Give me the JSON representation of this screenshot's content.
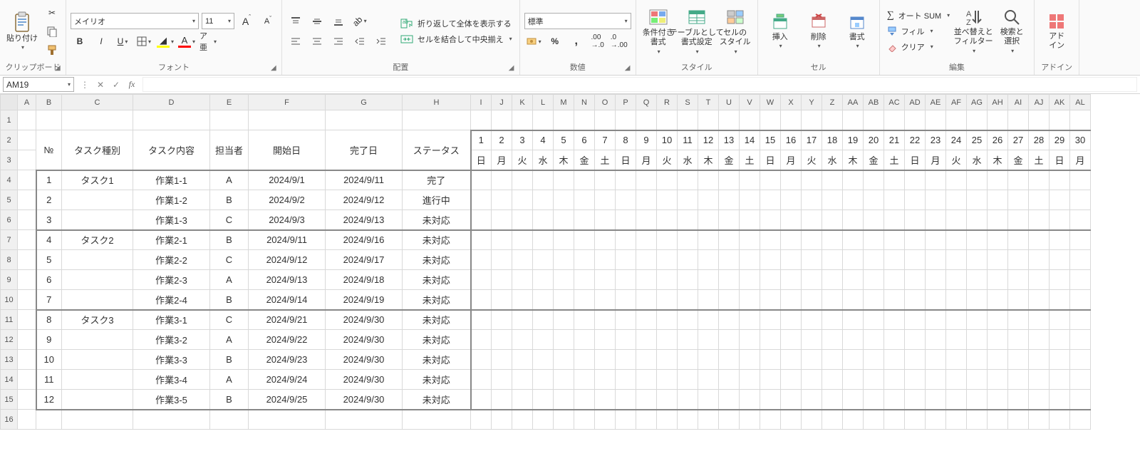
{
  "name_box": "AM19",
  "ribbon": {
    "clipboard": {
      "label": "クリップボード",
      "paste": "貼り付け"
    },
    "font": {
      "label": "フォント",
      "family": "メイリオ",
      "size": "11"
    },
    "align": {
      "label": "配置",
      "wrap": "折り返して全体を表示する",
      "merge": "セルを結合して中央揃え"
    },
    "number": {
      "label": "数値",
      "format": "標準"
    },
    "styles": {
      "label": "スタイル",
      "cond": "条件付き\n書式",
      "table": "テーブルとして\n書式設定",
      "cell": "セルの\nスタイル"
    },
    "cells": {
      "label": "セル",
      "insert": "挿入",
      "delete": "削除",
      "format": "書式"
    },
    "edit": {
      "label": "編集",
      "sum": "オート SUM",
      "fill": "フィル",
      "clear": "クリア",
      "sort": "並べ替えと\nフィルター",
      "find": "検索と\n選択"
    },
    "addin": {
      "label": "アドイン",
      "btn": "アド\nイン"
    }
  },
  "columns": [
    "A",
    "B",
    "C",
    "D",
    "E",
    "F",
    "G",
    "H",
    "I",
    "J",
    "K",
    "L",
    "M",
    "N",
    "O",
    "P",
    "Q",
    "R",
    "S",
    "T",
    "U",
    "V",
    "W",
    "X",
    "Y",
    "Z",
    "AA",
    "AB",
    "AC",
    "AD",
    "AE",
    "AF",
    "AG",
    "AH",
    "AI",
    "AJ",
    "AK",
    "AL"
  ],
  "col_widths": {
    "A": 26,
    "B": 36,
    "C": 100,
    "D": 108,
    "E": 54,
    "F": 108,
    "G": 108,
    "H": 96,
    "cal": 29
  },
  "main_headers": [
    "№",
    "タスク種別",
    "タスク内容",
    "担当者",
    "開始日",
    "完了日",
    "ステータス"
  ],
  "days": [
    1,
    2,
    3,
    4,
    5,
    6,
    7,
    8,
    9,
    10,
    11,
    12,
    13,
    14,
    15,
    16,
    17,
    18,
    19,
    20,
    21,
    22,
    23,
    24,
    25,
    26,
    27,
    28,
    29,
    30
  ],
  "dows": [
    "日",
    "月",
    "火",
    "水",
    "木",
    "金",
    "土",
    "日",
    "月",
    "火",
    "水",
    "木",
    "金",
    "土",
    "日",
    "月",
    "火",
    "水",
    "木",
    "金",
    "土",
    "日",
    "月",
    "火",
    "水",
    "木",
    "金",
    "土",
    "日",
    "月"
  ],
  "tasks": [
    {
      "no": 1,
      "type": "タスク1",
      "work": "作業1-1",
      "owner": "A",
      "start": "2024/9/1",
      "end": "2024/9/11",
      "status": "完了"
    },
    {
      "no": 2,
      "type": "",
      "work": "作業1-2",
      "owner": "B",
      "start": "2024/9/2",
      "end": "2024/9/12",
      "status": "進行中"
    },
    {
      "no": 3,
      "type": "",
      "work": "作業1-3",
      "owner": "C",
      "start": "2024/9/3",
      "end": "2024/9/13",
      "status": "未対応"
    },
    {
      "no": 4,
      "type": "タスク2",
      "work": "作業2-1",
      "owner": "B",
      "start": "2024/9/11",
      "end": "2024/9/16",
      "status": "未対応"
    },
    {
      "no": 5,
      "type": "",
      "work": "作業2-2",
      "owner": "C",
      "start": "2024/9/12",
      "end": "2024/9/17",
      "status": "未対応"
    },
    {
      "no": 6,
      "type": "",
      "work": "作業2-3",
      "owner": "A",
      "start": "2024/9/13",
      "end": "2024/9/18",
      "status": "未対応"
    },
    {
      "no": 7,
      "type": "",
      "work": "作業2-4",
      "owner": "B",
      "start": "2024/9/14",
      "end": "2024/9/19",
      "status": "未対応"
    },
    {
      "no": 8,
      "type": "タスク3",
      "work": "作業3-1",
      "owner": "C",
      "start": "2024/9/21",
      "end": "2024/9/30",
      "status": "未対応"
    },
    {
      "no": 9,
      "type": "",
      "work": "作業3-2",
      "owner": "A",
      "start": "2024/9/22",
      "end": "2024/9/30",
      "status": "未対応"
    },
    {
      "no": 10,
      "type": "",
      "work": "作業3-3",
      "owner": "B",
      "start": "2024/9/23",
      "end": "2024/9/30",
      "status": "未対応"
    },
    {
      "no": 11,
      "type": "",
      "work": "作業3-4",
      "owner": "A",
      "start": "2024/9/24",
      "end": "2024/9/30",
      "status": "未対応"
    },
    {
      "no": 12,
      "type": "",
      "work": "作業3-5",
      "owner": "B",
      "start": "2024/9/25",
      "end": "2024/9/30",
      "status": "未対応"
    }
  ],
  "group_breaks": [
    3,
    7,
    12
  ]
}
